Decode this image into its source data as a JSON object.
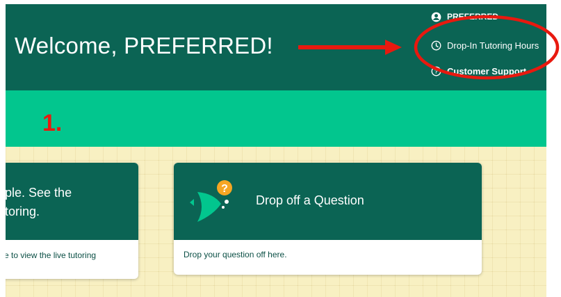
{
  "header": {
    "welcome": "Welcome, PREFERRED!",
    "nav": {
      "user_label": "PREFERRED",
      "user_icon": "account-circle-icon",
      "hours_label": "Drop-In Tutoring Hours",
      "hours_icon": "clock-icon",
      "support_label": "Customer Support",
      "support_icon": "help-circle-icon"
    }
  },
  "annotation": {
    "step_label": "1.",
    "color": "#e8190f"
  },
  "cards": {
    "live": {
      "title_line1": "ple. See the",
      "title_line2": "toring.",
      "body": "e to view the live tutoring"
    },
    "question": {
      "title": "Drop off a Question",
      "body": "Drop your question off here.",
      "icon": "drop-question-icon"
    }
  },
  "colors": {
    "header_bg": "#0b6454",
    "band_bg": "#02c68e",
    "grid_bg": "#f8f0c2",
    "accent_orange": "#f6a623"
  }
}
